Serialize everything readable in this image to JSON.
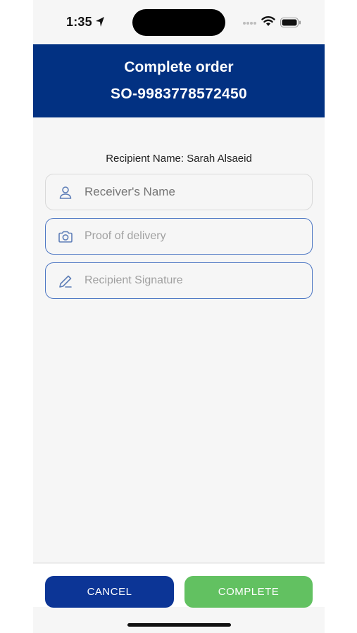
{
  "status": {
    "time": "1:35"
  },
  "header": {
    "title": "Complete order",
    "order_number": "SO-9983778572450"
  },
  "recipient": {
    "label": "Recipient Name: Sarah Alsaeid"
  },
  "form": {
    "receiver_name": {
      "placeholder": "Receiver's Name",
      "value": "",
      "icon": "person-icon"
    },
    "proof_of_delivery": {
      "placeholder": "Proof of delivery",
      "icon": "camera-icon"
    },
    "signature": {
      "placeholder": "Recipient Signature",
      "icon": "pencil-icon"
    }
  },
  "actions": {
    "cancel_label": "CANCEL",
    "complete_label": "COMPLETE"
  },
  "colors": {
    "header_bg": "#023182",
    "cancel_bg": "#0c3596",
    "complete_bg": "#62c161",
    "field_border_active": "#4f78c4"
  }
}
